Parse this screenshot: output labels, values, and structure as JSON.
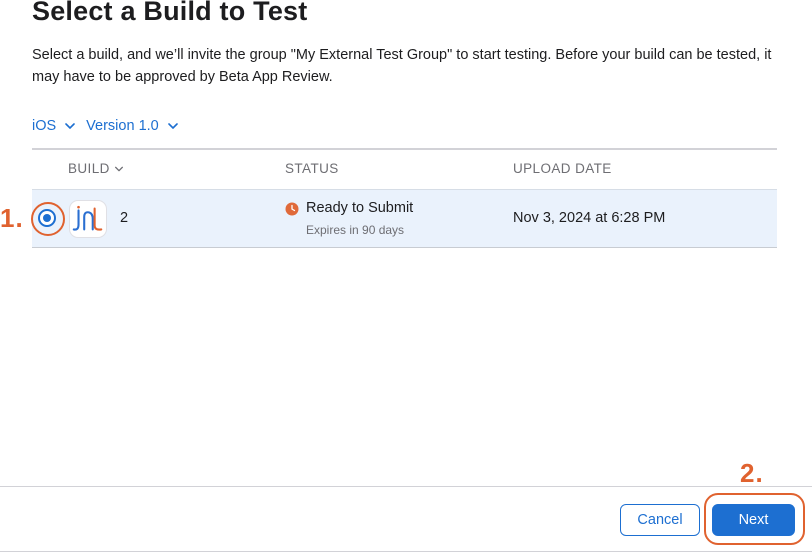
{
  "page": {
    "title": "Select a Build to Test",
    "description": "Select a build, and we’ll invite the group \"My External Test Group\" to start testing. Before your build can be tested, it may have to be approved by Beta App Review."
  },
  "filters": {
    "platform": "iOS",
    "version": "Version 1.0"
  },
  "table": {
    "headers": {
      "build": "BUILD",
      "status": "STATUS",
      "upload_date": "UPLOAD DATE"
    },
    "rows": [
      {
        "build": "2",
        "status": "Ready to Submit",
        "status_sub": "Expires in 90 days",
        "upload_date": "Nov 3, 2024 at 6:28 PM",
        "selected": true
      }
    ]
  },
  "footer": {
    "cancel_label": "Cancel",
    "next_label": "Next"
  },
  "annotations": {
    "step1": "1.",
    "step2": "2."
  },
  "colors": {
    "accent": "#1d6fd1",
    "annotation": "#e0622f",
    "status_orange": "#e06a3a",
    "row_selected": "#eaf2fc"
  },
  "icons": {
    "filter_chevron": "chevron-down-icon",
    "status": "clock-status-icon",
    "app": "app-icon"
  }
}
